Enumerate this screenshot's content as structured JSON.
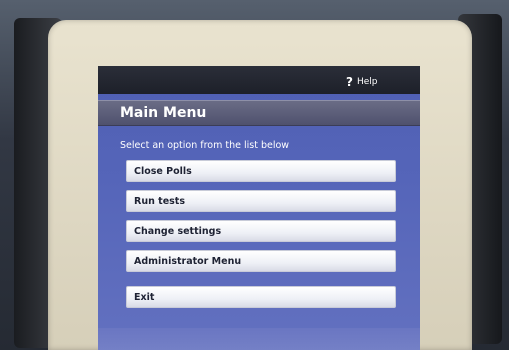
{
  "header": {
    "help_label": "Help"
  },
  "menu": {
    "title": "Main Menu",
    "instruction": "Select an option from the list below",
    "items": [
      {
        "label": "Close Polls"
      },
      {
        "label": "Run tests"
      },
      {
        "label": "Change settings"
      },
      {
        "label": "Administrator Menu"
      },
      {
        "label": "Exit"
      }
    ]
  },
  "colors": {
    "screen_bg": "#5565b9",
    "topbar_bg": "#1d2029",
    "title_bar": "#5d5f7a",
    "button_bg": "#f2f3f7",
    "frame": "#e2dcc7"
  },
  "icons": {
    "help": "question-mark-icon"
  }
}
